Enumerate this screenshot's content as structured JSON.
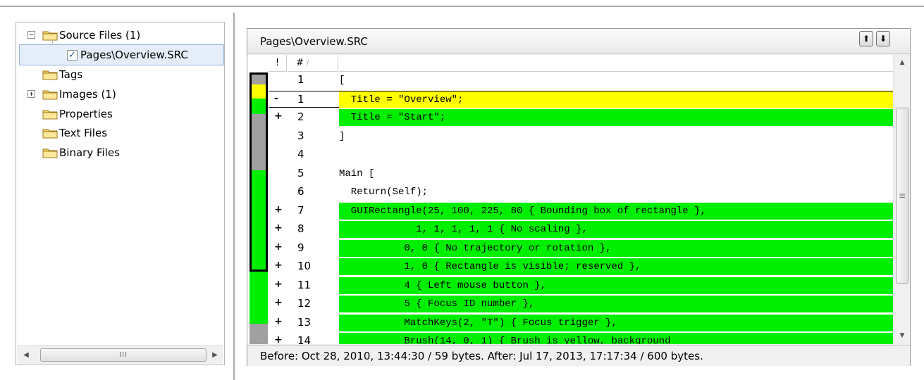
{
  "tree": {
    "items": [
      {
        "label": "Source Files (1)",
        "expander": "minus"
      },
      {
        "label": "Pages\\Overview.SRC",
        "checked": "✓"
      },
      {
        "label": "Tags"
      },
      {
        "label": "Images (1)",
        "expander": "plus"
      },
      {
        "label": "Properties"
      },
      {
        "label": "Text Files"
      },
      {
        "label": "Binary Files"
      }
    ],
    "scroll_grip": "III",
    "scroll_left_icon": "arrow-left-icon",
    "scroll_right_icon": "arrow-right-icon"
  },
  "diff": {
    "title": "Pages\\Overview.SRC",
    "prev_icon": "arrow-up-icon",
    "next_icon": "arrow-down-icon",
    "columns": {
      "flag": "!",
      "number": "#",
      "sort_glyph": "/"
    },
    "colors": {
      "added": "#00ee00",
      "removed": "#ffff00",
      "unchanged": "#a0a0a0"
    },
    "lines": [
      {
        "mark": "",
        "num": "1",
        "code": "[",
        "type": "plain"
      },
      {
        "mark": "-",
        "num": "1",
        "code": "  Title = \"Overview\";",
        "type": "removed"
      },
      {
        "mark": "+",
        "num": "2",
        "code": "  Title = \"Start\";",
        "type": "added"
      },
      {
        "mark": "",
        "num": "3",
        "code": "]",
        "type": "plain"
      },
      {
        "mark": "",
        "num": "4",
        "code": "",
        "type": "plain"
      },
      {
        "mark": "",
        "num": "5",
        "code": "Main [",
        "type": "plain"
      },
      {
        "mark": "",
        "num": "6",
        "code": "  Return(Self);",
        "type": "plain"
      },
      {
        "mark": "+",
        "num": "7",
        "code": "  GUIRectangle(25, 100, 225, 80 { Bounding box of rectangle },",
        "type": "added"
      },
      {
        "mark": "+",
        "num": "8",
        "code": "             1, 1, 1, 1, 1 { No scaling },",
        "type": "added"
      },
      {
        "mark": "+",
        "num": "9",
        "code": "           0, 0 { No trajectory or rotation },",
        "type": "added"
      },
      {
        "mark": "+",
        "num": "10",
        "code": "           1, 0 { Rectangle is visible; reserved },",
        "type": "added"
      },
      {
        "mark": "+",
        "num": "11",
        "code": "           4 { Left mouse button },",
        "type": "added"
      },
      {
        "mark": "+",
        "num": "12",
        "code": "           5 { Focus ID number },",
        "type": "added"
      },
      {
        "mark": "+",
        "num": "13",
        "code": "           MatchKeys(2, \"T\") { Focus trigger },",
        "type": "added"
      },
      {
        "mark": "+",
        "num": "14",
        "code": "           Brush(14, 0, 1) { Brush is yellow, background",
        "type": "added"
      }
    ],
    "scroll_up_icon": "arrow-up-small-icon",
    "scroll_down_icon": "arrow-down-small-icon",
    "scroll_grip": "≡",
    "status": "Before: Oct 28, 2010,  13:44:30 / 59 bytes.   After: Jul 17, 2013, 17:17:34 / 600 bytes."
  }
}
